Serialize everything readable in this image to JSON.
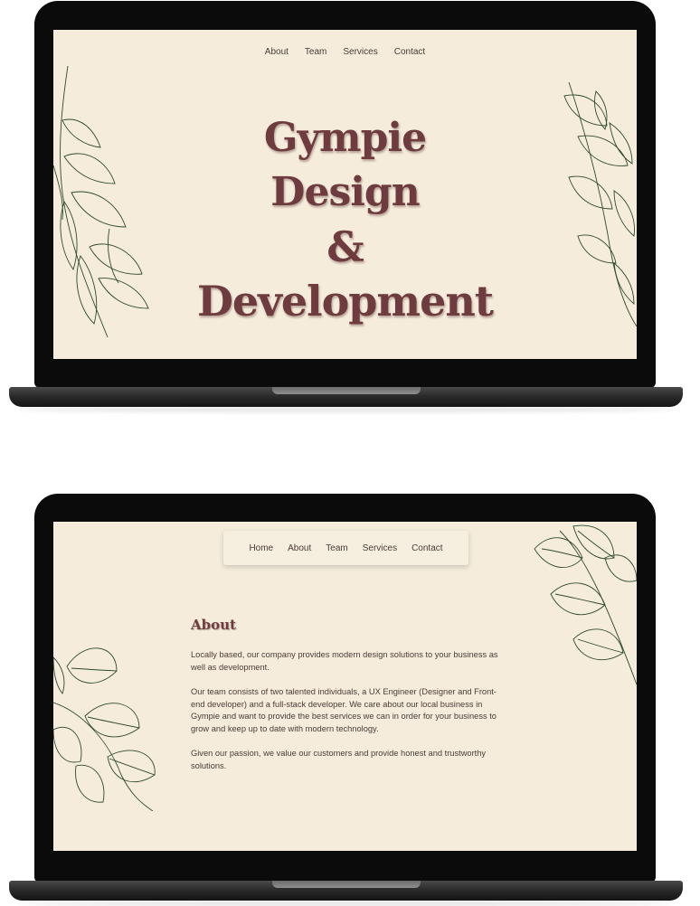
{
  "hero_page": {
    "nav": [
      "About",
      "Team",
      "Services",
      "Contact"
    ],
    "title_lines": [
      "Gympie",
      "Design",
      "&",
      "Development"
    ]
  },
  "about_page": {
    "nav": [
      "Home",
      "About",
      "Team",
      "Services",
      "Contact"
    ],
    "heading": "About",
    "paragraphs": [
      "Locally based, our company provides modern design solutions to your business as well as development.",
      "Our team consists of two talented individuals, a UX Engineer (Designer and Front-end developer) and a full-stack developer. We care about our local business in Gympie and want to provide the best services we can in order for your business to grow and keep up to date with modern technology.",
      "Given our passion, we value our customers and provide honest and trustworthy solutions."
    ]
  },
  "colors": {
    "background": "#f5ecdb",
    "title": "#6e3b3e",
    "text": "#4b3b38",
    "leaf_stroke": "#2f4a2c"
  },
  "icons": [
    "leaf-illustration-icon"
  ]
}
